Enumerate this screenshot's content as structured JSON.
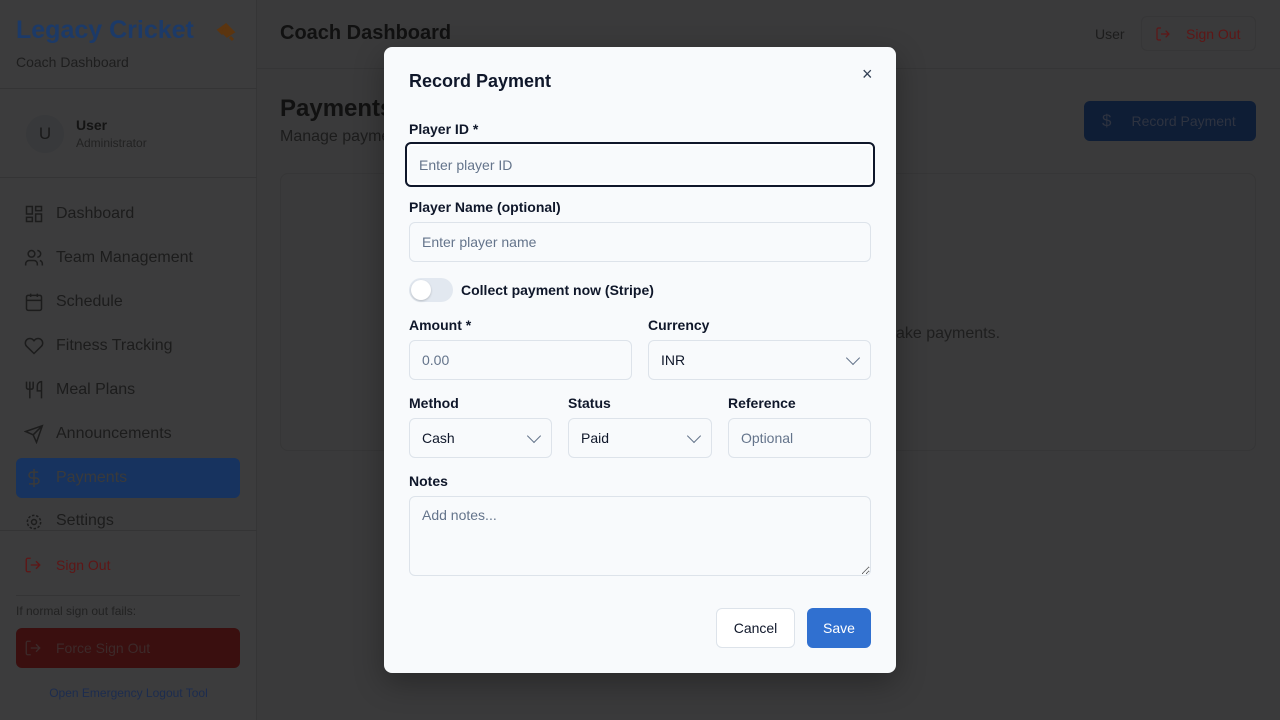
{
  "sidebar": {
    "brand": "Legacy Cricket",
    "subtitle": "Coach Dashboard",
    "user": {
      "initial": "U",
      "name": "User",
      "role": "Administrator"
    },
    "items": [
      {
        "label": "Dashboard",
        "icon": "grid-icon"
      },
      {
        "label": "Team Management",
        "icon": "users-icon"
      },
      {
        "label": "Schedule",
        "icon": "calendar-icon"
      },
      {
        "label": "Fitness Tracking",
        "icon": "heart-icon"
      },
      {
        "label": "Meal Plans",
        "icon": "utensils-icon"
      },
      {
        "label": "Announcements",
        "icon": "send-icon"
      },
      {
        "label": "Payments",
        "icon": "dollar-icon",
        "active": true
      },
      {
        "label": "Settings",
        "icon": "gear-icon"
      }
    ],
    "sign_out": "Sign Out",
    "fail_note": "If normal sign out fails:",
    "force_sign_out": "Force Sign Out",
    "emergency_link": "Open Emergency Logout Tool"
  },
  "header": {
    "title": "Coach Dashboard",
    "user": "User",
    "sign_out": "Sign Out"
  },
  "page": {
    "title": "Payments",
    "subtitle": "Manage payme",
    "record_button": "Record Payment",
    "empty_text": "ake payments."
  },
  "modal": {
    "title": "Record Payment",
    "close": "×",
    "player_id": {
      "label": "Player ID *",
      "placeholder": "Enter player ID"
    },
    "player_name": {
      "label": "Player Name (optional)",
      "placeholder": "Enter player name"
    },
    "stripe_toggle": {
      "label": "Collect payment now (Stripe)",
      "on": false
    },
    "amount": {
      "label": "Amount *",
      "placeholder": "0.00"
    },
    "currency": {
      "label": "Currency",
      "value": "INR"
    },
    "method": {
      "label": "Method",
      "value": "Cash"
    },
    "status": {
      "label": "Status",
      "value": "Paid"
    },
    "reference": {
      "label": "Reference",
      "placeholder": "Optional"
    },
    "notes": {
      "label": "Notes",
      "placeholder": "Add notes..."
    },
    "cancel": "Cancel",
    "save": "Save"
  },
  "colors": {
    "save": "#3070d0",
    "overlay_dim": "#3a3a3b"
  }
}
